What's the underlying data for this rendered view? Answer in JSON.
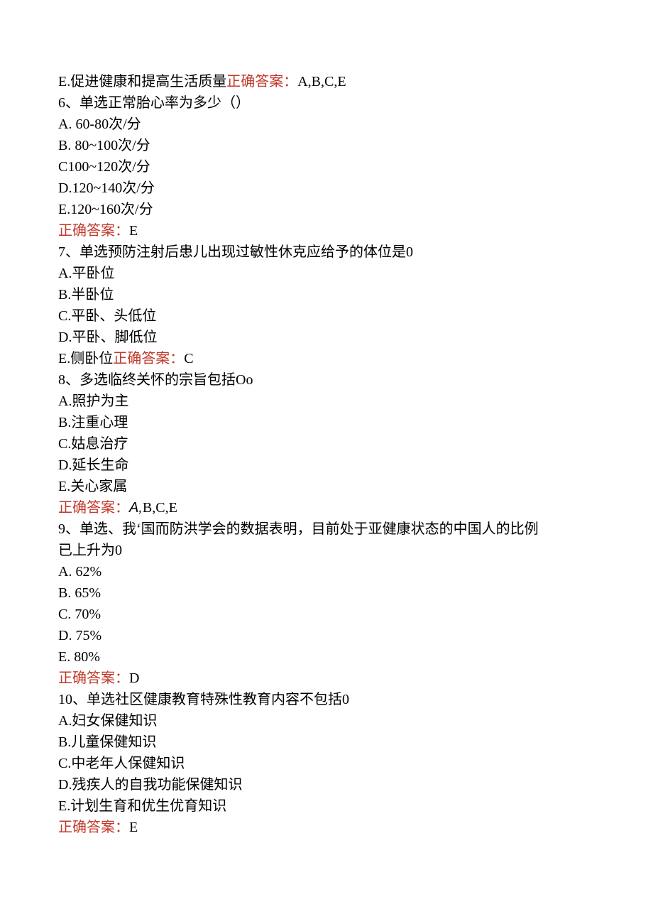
{
  "q5": {
    "optE": "E.促进健康和提高生活质量",
    "ansLabel": "正确答案：",
    "ansVal": "A,B,C,E"
  },
  "q6": {
    "stem": "6、单选正常胎心率为多少（）",
    "optA": "A. 60-80次/分",
    "optB": "B. 80~100次/分",
    "optC": "C100~120次/分",
    "optD": "D.120~140次/分",
    "optE": "E.120~160次/分",
    "ansLabel": "正确答案：",
    "ansVal": "E"
  },
  "q7": {
    "stem": "7、单选预防注射后患儿出现过敏性休克应给予的体位是0",
    "optA": "A.平卧位",
    "optB": "B.半卧位",
    "optC": "C.平卧、头低位",
    "optD": "D.平卧、脚低位",
    "optE": "E.侧卧位",
    "ansLabel": "正确答案：",
    "ansVal": "C"
  },
  "q8": {
    "stem": "8、多选临终关怀的宗旨包括Oo",
    "optA": "A.照护为主",
    "optB": "B.注重心理",
    "optC": "C.姑息治疗",
    "optD": "D.延长生命",
    "optE": "E.关心家属",
    "ansLabel": "正确答案：",
    "ansValA": "A,",
    "ansValRest": "B,C,E"
  },
  "q9": {
    "stem1": "9、单选、我‘国而防洪学会的数据表明，目前处于亚健康状态的中国人的比例",
    "stem2": "已上升为0",
    "optA": "A. 62%",
    "optB": "B. 65%",
    "optC": "C. 70%",
    "optD": "D. 75%",
    "optE": "E. 80%",
    "ansLabel": "正确答案：",
    "ansVal": "D"
  },
  "q10": {
    "stem": "10、单选社区健康教育特殊性教育内容不包括0",
    "optA": "A.妇女保健知识",
    "optB": "B.儿童保健知识",
    "optC": "C.中老年人保健知识",
    "optD": "D.残疾人的自我功能保健知识",
    "optE": "E.计划生育和优生优育知识",
    "ansLabel": "正确答案：",
    "ansVal": "E"
  }
}
